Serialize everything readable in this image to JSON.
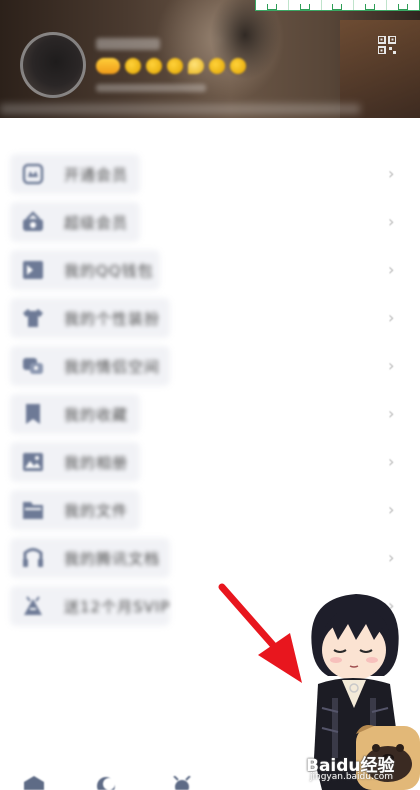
{
  "menu": {
    "items": [
      {
        "label": "开通会员",
        "icon": "crown-card-icon"
      },
      {
        "label": "超级会员",
        "icon": "shopping-basket-icon"
      },
      {
        "label": "我的QQ钱包",
        "icon": "wallet-icon"
      },
      {
        "label": "我的个性装扮",
        "icon": "tshirt-icon"
      },
      {
        "label": "我的情侣空间",
        "icon": "couple-space-icon"
      },
      {
        "label": "我的收藏",
        "icon": "bookmark-icon"
      },
      {
        "label": "我的相册",
        "icon": "photo-album-icon"
      },
      {
        "label": "我的文件",
        "icon": "folder-icon"
      },
      {
        "label": "我的腾讯文档",
        "icon": "music-doc-icon"
      },
      {
        "label": "送12个月SVIP",
        "icon": "gift-icon"
      }
    ],
    "chevron": "›"
  },
  "watermark": {
    "brand": "Baidu经验",
    "url": "jingyan.baidu.com"
  },
  "colors": {
    "icon": "#6d7a96",
    "arrow": "#e8161e",
    "toolbar_border": "#3aa864"
  },
  "header_icons": [
    "avatar",
    "qr-code-icon"
  ],
  "toolbar_icons": [
    "toolbar-copy-icon",
    "toolbar-expand-icon",
    "toolbar-home-icon",
    "toolbar-window-icon",
    "toolbar-settings-icon"
  ],
  "bottom_icons": [
    "settings-icon",
    "moon-icon",
    "weather-icon"
  ]
}
